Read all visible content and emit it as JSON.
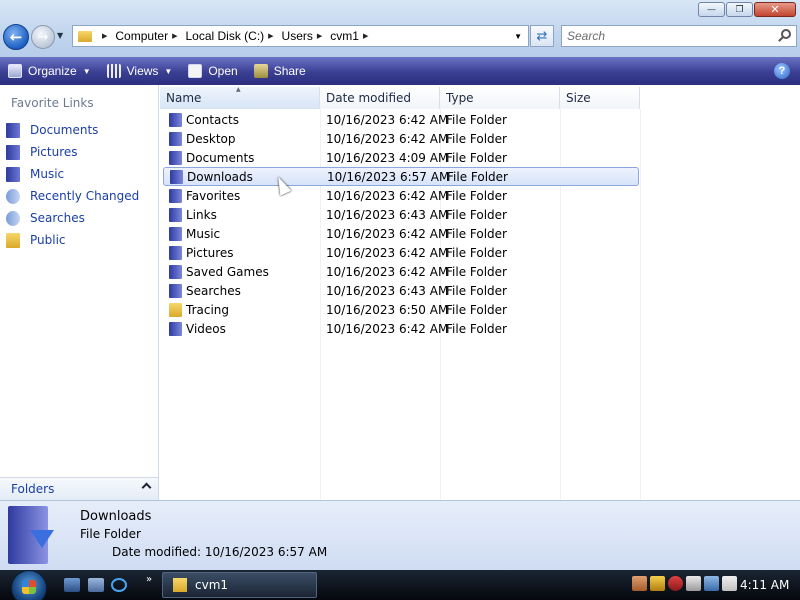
{
  "window": {
    "minimize": "—",
    "maximize": "❐",
    "close": "✕"
  },
  "address": {
    "crumbs": [
      "Computer",
      "Local Disk (C:)",
      "Users",
      "cvm1"
    ],
    "search_placeholder": "Search"
  },
  "toolbar": {
    "organize": "Organize",
    "views": "Views",
    "open": "Open",
    "share": "Share",
    "help": "?"
  },
  "navpane": {
    "header": "Favorite Links",
    "items": [
      {
        "label": "Documents",
        "icon": "documents-icon"
      },
      {
        "label": "Pictures",
        "icon": "pictures-icon"
      },
      {
        "label": "Music",
        "icon": "music-icon"
      },
      {
        "label": "Recently Changed",
        "icon": "recently-changed-icon"
      },
      {
        "label": "Searches",
        "icon": "searches-icon"
      },
      {
        "label": "Public",
        "icon": "public-folder-icon"
      }
    ],
    "folders_label": "Folders"
  },
  "columns": {
    "name": "Name",
    "date": "Date modified",
    "type": "Type",
    "size": "Size"
  },
  "files": [
    {
      "name": "Contacts",
      "date": "10/16/2023 6:42 AM",
      "type": "File Folder"
    },
    {
      "name": "Desktop",
      "date": "10/16/2023 6:42 AM",
      "type": "File Folder"
    },
    {
      "name": "Documents",
      "date": "10/16/2023 4:09 AM",
      "type": "File Folder"
    },
    {
      "name": "Downloads",
      "date": "10/16/2023 6:57 AM",
      "type": "File Folder"
    },
    {
      "name": "Favorites",
      "date": "10/16/2023 6:42 AM",
      "type": "File Folder"
    },
    {
      "name": "Links",
      "date": "10/16/2023 6:43 AM",
      "type": "File Folder"
    },
    {
      "name": "Music",
      "date": "10/16/2023 6:42 AM",
      "type": "File Folder"
    },
    {
      "name": "Pictures",
      "date": "10/16/2023 6:42 AM",
      "type": "File Folder"
    },
    {
      "name": "Saved Games",
      "date": "10/16/2023 6:42 AM",
      "type": "File Folder"
    },
    {
      "name": "Searches",
      "date": "10/16/2023 6:43 AM",
      "type": "File Folder"
    },
    {
      "name": "Tracing",
      "date": "10/16/2023 6:50 AM",
      "type": "File Folder"
    },
    {
      "name": "Videos",
      "date": "10/16/2023 6:42 AM",
      "type": "File Folder"
    }
  ],
  "selected_index": 3,
  "details": {
    "name": "Downloads",
    "type": "File Folder",
    "modified": "Date modified: 10/16/2023 6:57 AM"
  },
  "taskbar": {
    "more": "»",
    "task": "cvm1",
    "clock": "4:11 AM"
  },
  "colors": {
    "toolbar": "#3a3f93",
    "link": "#1a3fa6",
    "selection_border": "#8aa7de"
  }
}
